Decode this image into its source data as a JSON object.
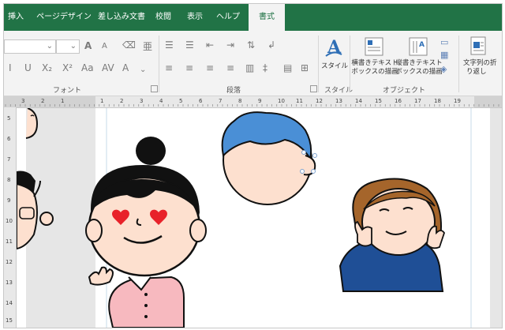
{
  "tabs": [
    {
      "label": "挿入",
      "active": false
    },
    {
      "label": "ページデザイン",
      "active": false
    },
    {
      "label": "差し込み文書",
      "active": false
    },
    {
      "label": "校閲",
      "active": false
    },
    {
      "label": "表示",
      "active": false
    },
    {
      "label": "ヘルプ",
      "active": false
    },
    {
      "label": "書式",
      "active": true
    }
  ],
  "colors": {
    "tab_bar": "#217346",
    "accent_blue": "#2f6fb6",
    "heart_red": "#e8222a",
    "skin": "#fde0cf",
    "blue_hair": "#4a8fd6",
    "brown_hair": "#a5652b",
    "pink_shirt": "#f7b9bf",
    "navy_shirt": "#1f4f96"
  },
  "ribbon": {
    "font_group_label": "フォント",
    "paragraph_group_label": "段落",
    "style_group_label": "スタイル",
    "object_group_label": "オブジェクト",
    "style_button_label": "スタイル",
    "horizontal_textbox_line1": "横書きテキスト",
    "horizontal_textbox_line2": "ボックスの描画",
    "vertical_textbox_line1": "縦書きテキスト",
    "vertical_textbox_line2": "ボックスの描画",
    "wrap_text_line1": "文字列の折",
    "wrap_text_line2": "り返し",
    "font_buttons": [
      "I",
      "U",
      "X₂",
      "X²",
      "Aa",
      "AV",
      "A"
    ],
    "grow_font": "A",
    "shrink_font": "A"
  },
  "ruler_h_numbers": [
    "3",
    "2",
    "1",
    "",
    "1",
    "2",
    "3",
    "4",
    "5",
    "6",
    "7",
    "8",
    "9",
    "10",
    "11",
    "12",
    "13",
    "14",
    "15",
    "16",
    "17",
    "18",
    "19"
  ],
  "ruler_v_numbers": [
    "5",
    "6",
    "7",
    "8",
    "9",
    "10",
    "11",
    "12",
    "13",
    "14",
    "15"
  ]
}
